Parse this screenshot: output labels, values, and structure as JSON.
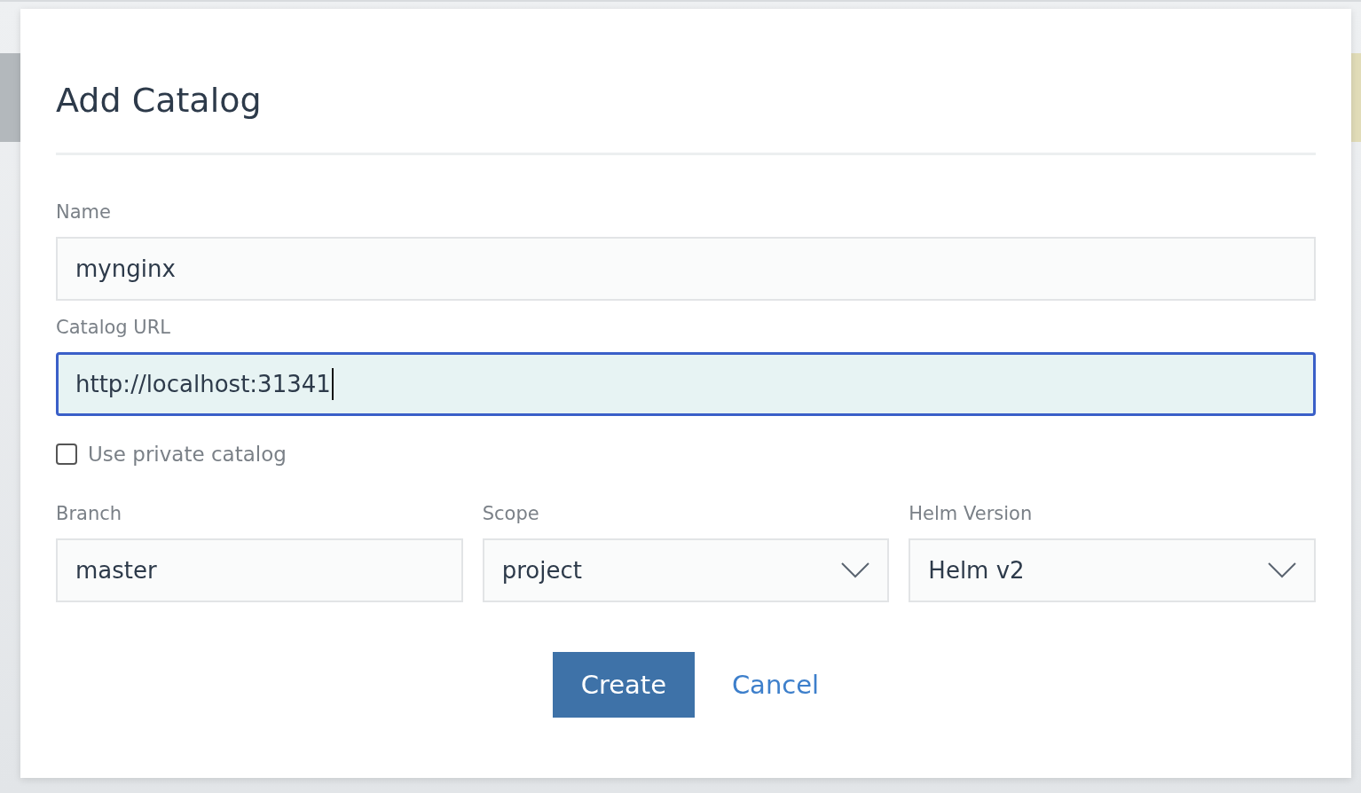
{
  "dialog": {
    "title": "Add Catalog",
    "fields": [
      {
        "label": "Name",
        "value": "mynginx",
        "focused": false
      },
      {
        "label": "Catalog URL",
        "value": "http://localhost:31341",
        "focused": true
      }
    ],
    "private_catalog": {
      "label": "Use private catalog",
      "checked": false
    },
    "options": [
      {
        "label": "Branch",
        "value": "master",
        "kind": "text"
      },
      {
        "label": "Scope",
        "value": "project",
        "kind": "select"
      },
      {
        "label": "Helm Version",
        "value": "Helm v2",
        "kind": "select"
      }
    ],
    "buttons": [
      {
        "label": "Create",
        "kind": "primary"
      },
      {
        "label": "Cancel",
        "kind": "link"
      }
    ]
  }
}
